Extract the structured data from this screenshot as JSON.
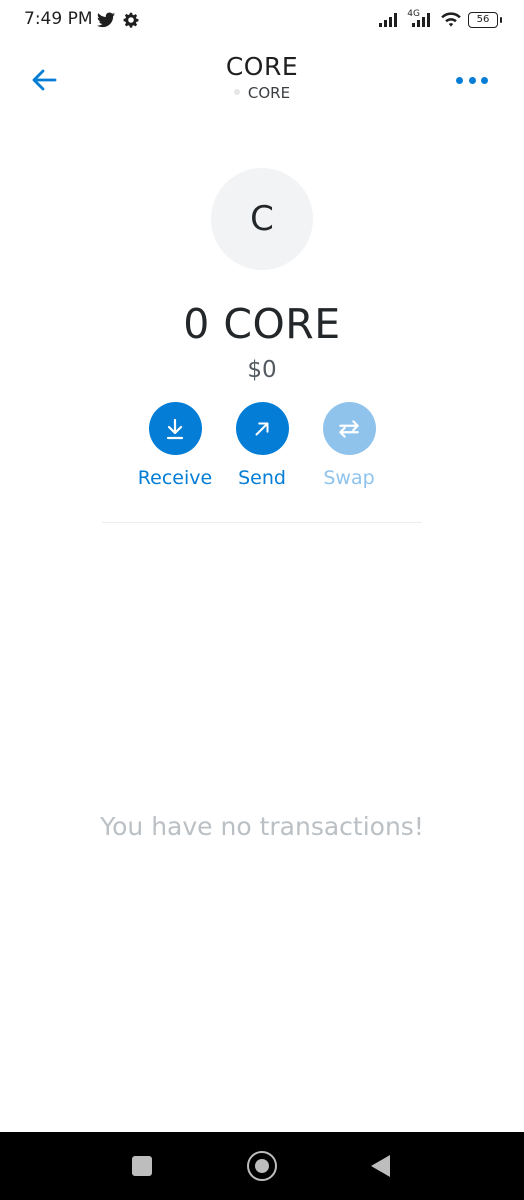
{
  "status_bar": {
    "time": "7:49 PM",
    "network_label": "4G",
    "battery": "56"
  },
  "header": {
    "title": "CORE",
    "subtitle": "CORE"
  },
  "token": {
    "avatar_letter": "C",
    "balance": "0 CORE",
    "fiat": "$0"
  },
  "actions": {
    "receive": "Receive",
    "send": "Send",
    "swap": "Swap"
  },
  "transactions": {
    "empty_message": "You have no transactions!"
  },
  "colors": {
    "accent": "#037dd6",
    "accent_disabled": "#8fc3ec",
    "muted_text": "#bbc0c5"
  },
  "icons": {
    "back": "arrow-left-icon",
    "more": "more-horizontal-icon",
    "receive": "download-icon",
    "send": "arrow-up-right-icon",
    "swap": "swap-icon"
  }
}
